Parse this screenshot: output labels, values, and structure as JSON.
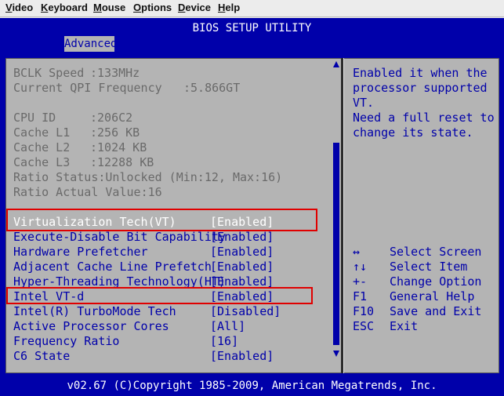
{
  "menubar": [
    "Video",
    "Keyboard",
    "Mouse",
    "Options",
    "Device",
    "Help"
  ],
  "title": "BIOS SETUP UTILITY",
  "active_tab": "Advanced",
  "info": [
    {
      "label": "BCLK Speed",
      "value": ":133MHz"
    },
    {
      "label": "Current QPI Frequency",
      "value": ":5.866GT"
    },
    {
      "label": "CPU ID",
      "value": ":206C2"
    },
    {
      "label": "Cache L1",
      "value": ":256 KB"
    },
    {
      "label": "Cache L2",
      "value": ":1024 KB"
    },
    {
      "label": "Cache L3",
      "value": ":12288 KB"
    },
    {
      "label": "Ratio Status",
      "value": ":Unlocked (Min:12, Max:16)"
    },
    {
      "label": "Ratio Actual Value",
      "value": ":16"
    }
  ],
  "settings": [
    {
      "label": "Virtualization Tech(VT)",
      "value": "[Enabled]",
      "selected": true
    },
    {
      "label": "Execute-Disable Bit Capability",
      "value": "[Enabled]"
    },
    {
      "label": "Hardware Prefetcher",
      "value": "[Enabled]"
    },
    {
      "label": "Adjacent Cache Line Prefetch",
      "value": "[Enabled]"
    },
    {
      "label": "Hyper-Threading Technology(HT)",
      "value": "[Enabled]"
    },
    {
      "label": "Intel VT-d",
      "value": "[Enabled]"
    },
    {
      "label": "Intel(R) TurboMode Tech",
      "value": "[Disabled]"
    },
    {
      "label": "Active Processor Cores",
      "value": "[All]"
    },
    {
      "label": "Frequency Ratio",
      "value": "[16]"
    },
    {
      "label": "C6 State",
      "value": "[Enabled]"
    }
  ],
  "help_text": [
    "Enabled it when the",
    "processor supported",
    "VT.",
    "Need a full reset to",
    "change its state."
  ],
  "key_help": [
    {
      "key": "↔",
      "action": "Select Screen"
    },
    {
      "key": "↑↓",
      "action": "Select Item"
    },
    {
      "key": "+-",
      "action": "Change Option"
    },
    {
      "key": "F1",
      "action": "General Help"
    },
    {
      "key": "F10",
      "action": "Save and Exit"
    },
    {
      "key": "ESC",
      "action": "Exit"
    }
  ],
  "footer": "v02.67 (C)Copyright 1985-2009, American Megatrends, Inc.",
  "colors": {
    "bios_blue": "#0000aa",
    "panel_gray": "#b4b4b4",
    "highlight_red": "#e00000"
  }
}
